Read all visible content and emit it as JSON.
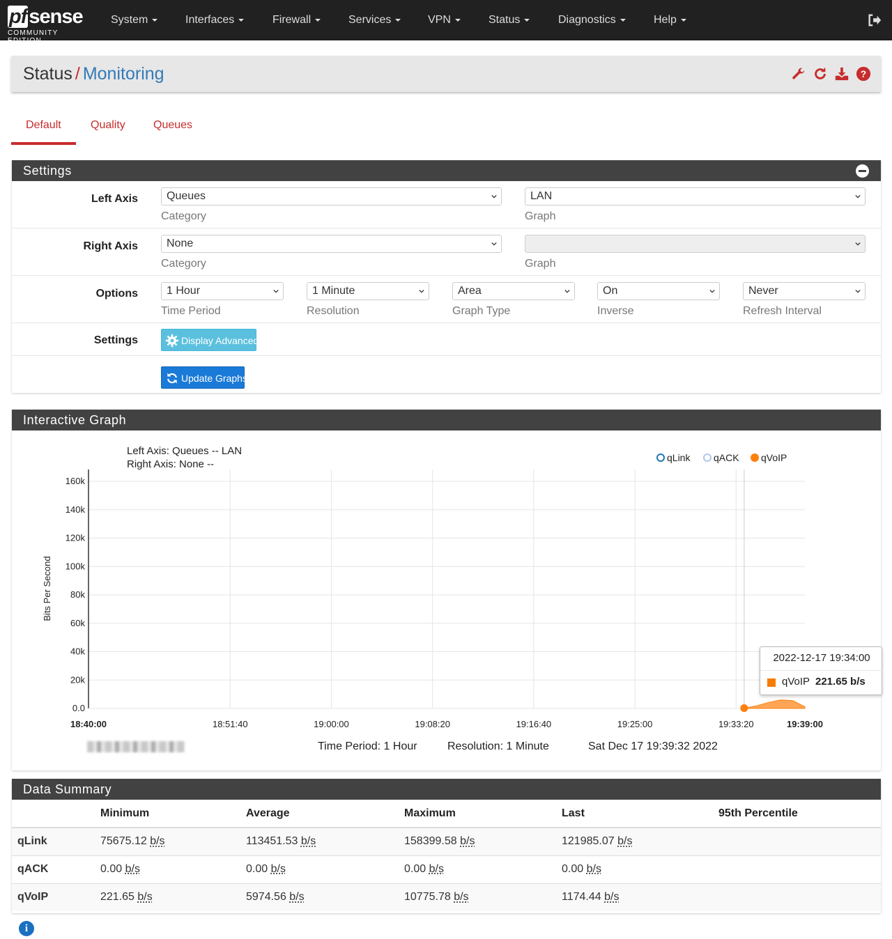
{
  "brand": {
    "logo_pf": "pf",
    "logo_rest": "sense",
    "edition": "COMMUNITY EDITION"
  },
  "nav": {
    "items": [
      "System",
      "Interfaces",
      "Firewall",
      "Services",
      "VPN",
      "Status",
      "Diagnostics",
      "Help"
    ]
  },
  "breadcrumb": {
    "parent": "Status",
    "separator": "/",
    "current": "Monitoring"
  },
  "header_icons": [
    "wrench-icon",
    "refresh-icon",
    "download-icon",
    "help-icon"
  ],
  "tabs": [
    "Default",
    "Quality",
    "Queues"
  ],
  "settings": {
    "title": "Settings",
    "left_axis": {
      "label": "Left Axis",
      "category": "Queues",
      "category_help": "Category",
      "graph": "LAN",
      "graph_help": "Graph"
    },
    "right_axis": {
      "label": "Right Axis",
      "category": "None",
      "category_help": "Category",
      "graph": "",
      "graph_help": "Graph"
    },
    "options": {
      "label": "Options",
      "time_period": "1 Hour",
      "time_period_help": "Time Period",
      "resolution": "1 Minute",
      "resolution_help": "Resolution",
      "graph_type": "Area",
      "graph_type_help": "Graph Type",
      "inverse": "On",
      "inverse_help": "Inverse",
      "refresh": "Never",
      "refresh_help": "Refresh Interval"
    },
    "settings_label": "Settings",
    "display_advanced": "Display Advanced",
    "update_graphs": "Update Graphs"
  },
  "graph": {
    "title": "Interactive Graph",
    "left_axis_caption": "Left Axis: Queues -- LAN",
    "right_axis_caption": "Right Axis: None --",
    "time_period": "Time Period: 1 Hour",
    "resolution": "Resolution: 1 Minute",
    "timestamp": "Sat Dec 17 19:39:32 2022",
    "tooltip": {
      "time": "2022-12-17 19:34:00",
      "series": "qVoIP",
      "value": "221.65 b/s"
    }
  },
  "chart_data": {
    "type": "area",
    "ylabel": "Bits Per Second",
    "ylim": [
      0,
      160000
    ],
    "y_ticks": [
      "0.0",
      "20k",
      "40k",
      "60k",
      "80k",
      "100k",
      "120k",
      "140k",
      "160k"
    ],
    "x_ticks": [
      "18:40:00",
      "18:51:40",
      "19:00:00",
      "19:08:20",
      "19:16:40",
      "19:25:00",
      "19:33:20",
      "19:39:00"
    ],
    "legend": {
      "position": "top-right"
    },
    "series": [
      {
        "name": "qLink",
        "color": "#1f77b4",
        "values": []
      },
      {
        "name": "qACK",
        "color": "#aec7e8",
        "values": []
      },
      {
        "name": "qVoIP",
        "color": "#ff7f0e",
        "x": [
          "19:34:00",
          "19:35:00",
          "19:36:00",
          "19:37:00",
          "19:38:00",
          "19:39:00"
        ],
        "values": [
          221.65,
          1800,
          4200,
          6000,
          5500,
          1174.44
        ]
      }
    ]
  },
  "summary": {
    "title": "Data Summary",
    "columns": [
      "Minimum",
      "Average",
      "Maximum",
      "Last",
      "95th Percentile"
    ],
    "unit": "b/s",
    "rows": [
      {
        "name": "qLink",
        "values": [
          "75675.12",
          "113451.53",
          "158399.58",
          "121985.07"
        ]
      },
      {
        "name": "qACK",
        "values": [
          "0.00",
          "0.00",
          "0.00",
          "0.00"
        ]
      },
      {
        "name": "qVoIP",
        "values": [
          "221.65",
          "5974.56",
          "10775.78",
          "1174.44"
        ]
      }
    ]
  },
  "info_icon": "i"
}
